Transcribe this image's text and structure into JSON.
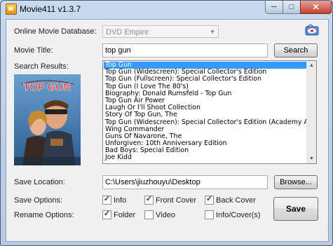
{
  "window": {
    "title": "Movie411 v1.3.7",
    "min_glyph": "─",
    "max_glyph": "□",
    "close_glyph": "✕"
  },
  "database": {
    "label": "Online Movie Database:",
    "selected": "DVD Empire"
  },
  "movie_title": {
    "label": "Movie Title:",
    "value": "top gun",
    "search_button": "Search"
  },
  "search_results": {
    "label": "Search Results:",
    "selected_index": 0,
    "items": [
      "Top Gun",
      "Top Gun (Widescreen): Special Collector's Edition",
      "Top Gun (Fullscreen): Special Collector's Edition",
      "Top Gun (I Love The 80's)",
      "Biography: Donald Rumsfeld - Top Gun",
      "Top Gun Air Power",
      "Laugh Or I'll Shoot Collection",
      "Story Of Top Gun, The",
      "Top Gun (Widescreen): Special Collector's Edition (Academy Awar",
      "Wing Commander",
      "Guns Of Navarone, The",
      "Unforgiven: 10th Anniversary Edition",
      "Bad Boys: Special Edition",
      "Joe Kidd"
    ]
  },
  "poster": {
    "title_text": "TOP GUN"
  },
  "save_location": {
    "label": "Save Location:",
    "value": "C:\\Users\\jiuzhouyu\\Desktop",
    "browse_button": "Browse..."
  },
  "save_options": {
    "label": "Save Options:",
    "info": {
      "label": "Info",
      "checked": true
    },
    "front_cover": {
      "label": "Front Cover",
      "checked": true
    },
    "back_cover": {
      "label": "Back Cover",
      "checked": true
    }
  },
  "rename_options": {
    "label": "Rename Options:",
    "folder": {
      "label": "Folder",
      "checked": true
    },
    "video": {
      "label": "Video",
      "checked": false
    },
    "info_cover": {
      "label": "Info/Cover(s)",
      "checked": false
    }
  },
  "save_button": "Save",
  "colors": {
    "selection": "#3399ff",
    "titlebar": "#c9d9ee",
    "close": "#c3402f"
  }
}
